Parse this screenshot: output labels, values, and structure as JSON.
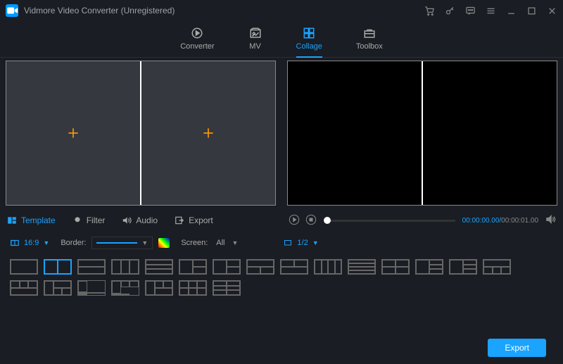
{
  "app": {
    "title": "Vidmore Video Converter (Unregistered)"
  },
  "nav": {
    "converter": "Converter",
    "mv": "MV",
    "collage": "Collage",
    "toolbox": "Toolbox"
  },
  "tabs": {
    "template": "Template",
    "filter": "Filter",
    "audio": "Audio",
    "export": "Export"
  },
  "player": {
    "current": "00:00:00.00",
    "total": "00:00:01.00",
    "sep": "/"
  },
  "options": {
    "aspect": "16:9",
    "border_label": "Border:",
    "screen_label": "Screen:",
    "screen_value": "All",
    "pages": "1/2"
  },
  "bottom": {
    "export": "Export"
  }
}
